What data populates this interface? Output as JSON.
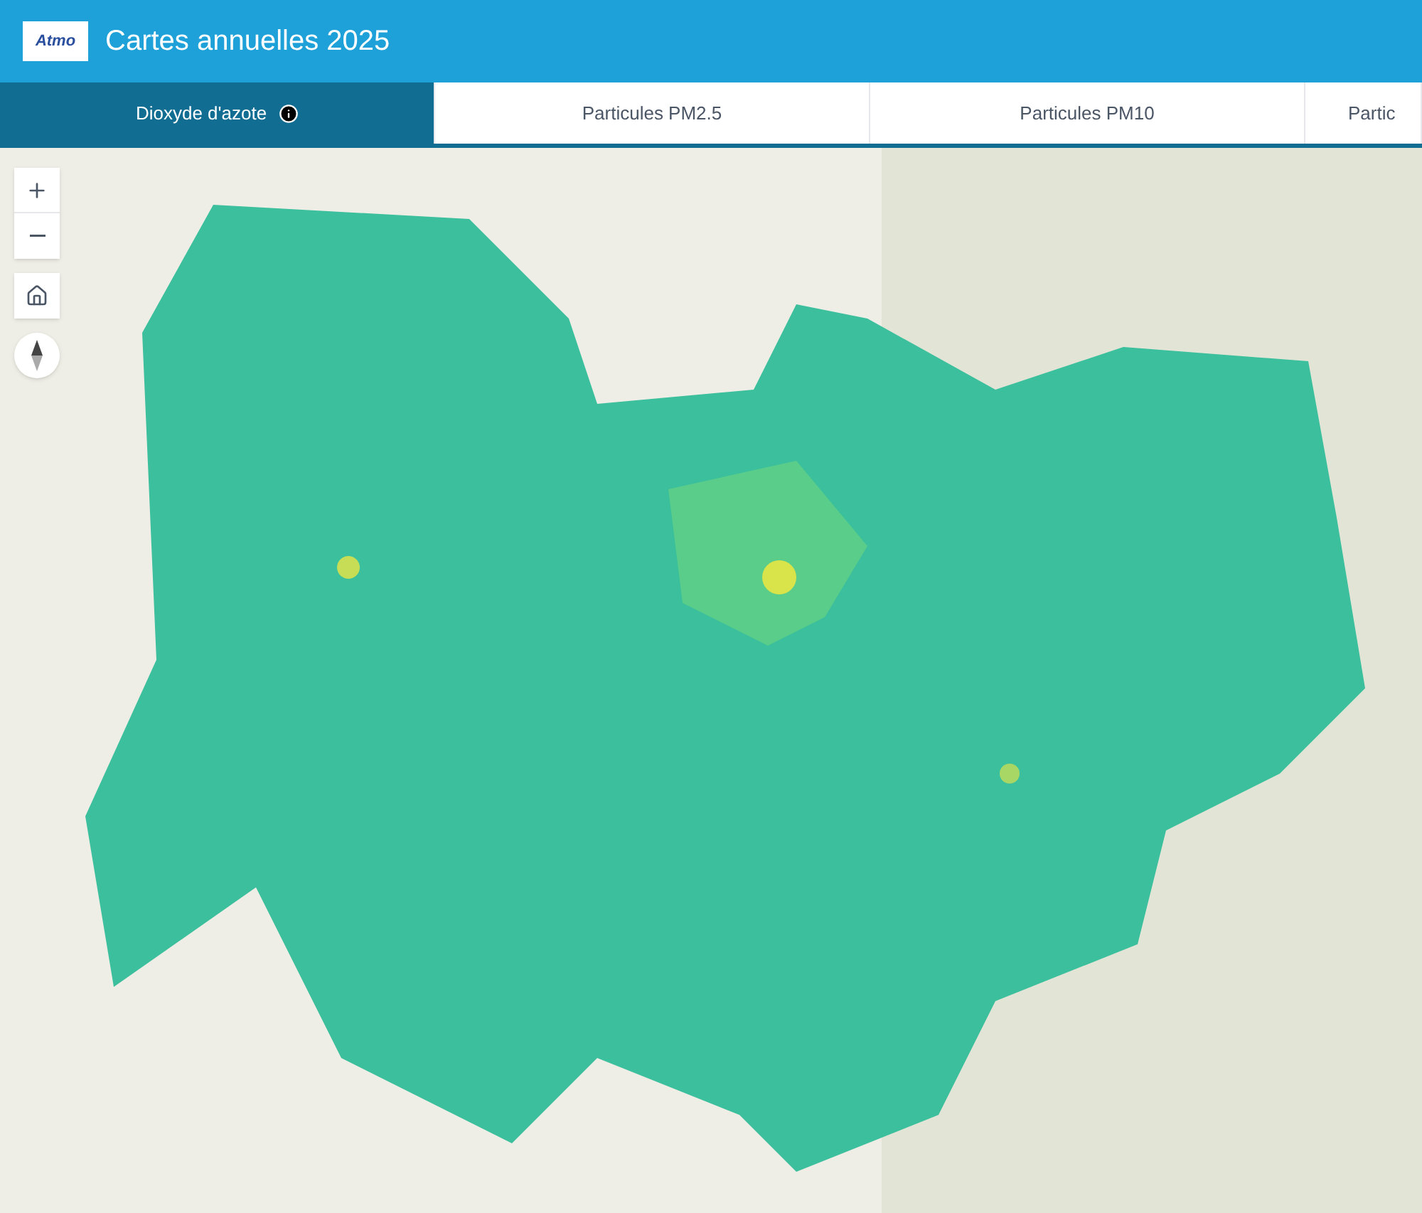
{
  "header": {
    "logo_text": "Atmo",
    "title": "Cartes annuelles 2025"
  },
  "tabs": [
    {
      "label": "Dioxyde d'azote",
      "selected": true,
      "info": true
    },
    {
      "label": "Particules PM2.5",
      "selected": false
    },
    {
      "label": "Particules PM10",
      "selected": false
    },
    {
      "label": "Partic",
      "selected": false
    }
  ]
}
